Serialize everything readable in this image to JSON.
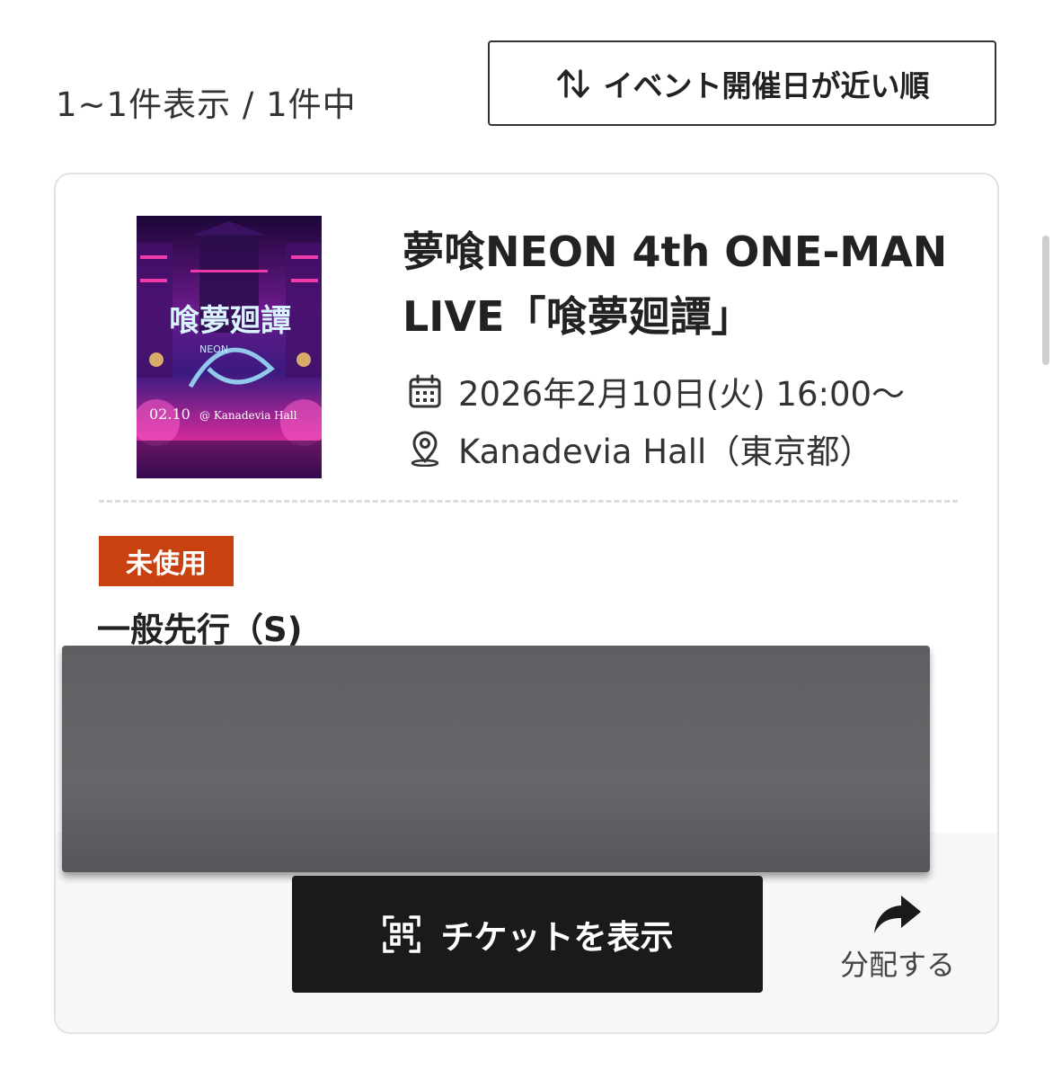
{
  "results": {
    "count_text": "1~1件表示 / 1件中"
  },
  "sort": {
    "label": "イベント開催日が近い順",
    "icon": "sort-arrows-icon"
  },
  "event": {
    "title": "夢喰NEON 4th ONE-MAN LIVE「喰夢廻譚」",
    "datetime": "2026年2月10日(火) 16:00～",
    "venue": "Kanadevia Hall（東京都）",
    "date_icon": "calendar-icon",
    "venue_icon": "location-pin-icon",
    "poster": {
      "title_text": "喰夢廻譚",
      "band_text": "NEON",
      "date_text": "02.10",
      "venue_text": "@ Kanadevia Hall"
    }
  },
  "ticket": {
    "status_badge": "未使用",
    "status_color": "#c8410f",
    "type": "一般先行（S)"
  },
  "actions": {
    "show_ticket_label": "チケットを表示",
    "show_ticket_icon": "qr-code-icon",
    "share_label": "分配する",
    "share_icon": "share-arrow-icon"
  }
}
